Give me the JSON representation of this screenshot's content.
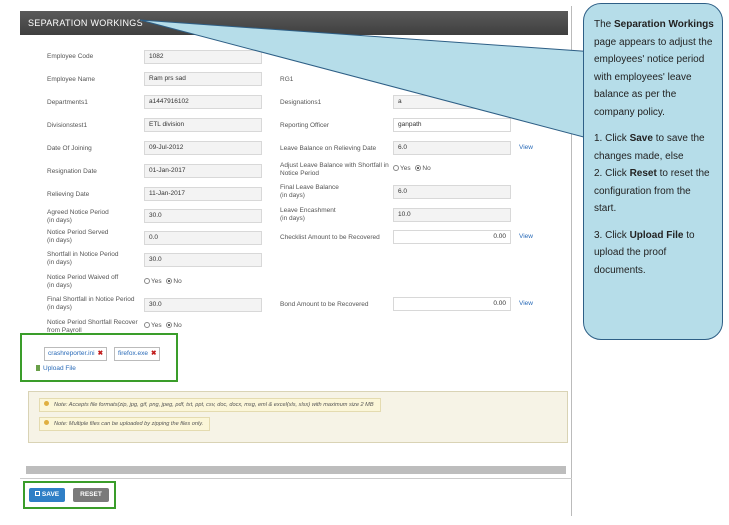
{
  "header": {
    "title": "SEPARATION WORKINGS"
  },
  "fields": {
    "employee_code": {
      "label": "Employee Code",
      "value": "1082"
    },
    "employee_name": {
      "label": "Employee Name",
      "value": "Ram prs sad"
    },
    "rg1": {
      "label": "RG1",
      "value": ""
    },
    "departments": {
      "label": "Departments1",
      "value": "a1447916102"
    },
    "designations": {
      "label": "Designations1",
      "value": "a"
    },
    "divisions": {
      "label": "Divisionstest1",
      "value": "ETL division"
    },
    "reporting_officer": {
      "label": "Reporting Officer",
      "value": "ganpath"
    },
    "date_of_joining": {
      "label": "Date Of Joining",
      "value": "09-Jul-2012"
    },
    "leave_balance_relieving": {
      "label": "Leave Balance on Relieving Date",
      "value": "6.0"
    },
    "resignation_date": {
      "label": "Resignation Date",
      "value": "01-Jan-2017"
    },
    "adjust_leave": {
      "label_l1": "Adjust Leave Balance with Shortfall in",
      "label_l2": "Notice Period",
      "opt_yes": "Yes",
      "opt_no": "No"
    },
    "relieving_date": {
      "label": "Relieving Date",
      "value": "11-Jan-2017"
    },
    "final_leave_balance": {
      "label_l1": "Final Leave Balance",
      "label_l2": "(in days)",
      "value": "6.0"
    },
    "agreed_notice": {
      "label_l1": "Agreed Notice Period",
      "label_l2": "(in days)",
      "value": "30.0"
    },
    "leave_encashment": {
      "label_l1": "Leave Encashment",
      "label_l2": "(in days)",
      "value": "10.0"
    },
    "notice_served": {
      "label_l1": "Notice Period Served",
      "label_l2": "(in days)",
      "value": "0.0"
    },
    "checklist_amount": {
      "label": "Checklist Amount to be Recovered",
      "value": "0.00"
    },
    "shortfall_notice": {
      "label_l1": "Shortfall in Notice Period",
      "label_l2": "(in days)",
      "value": "30.0"
    },
    "notice_waived": {
      "label_l1": "Notice Period Waived off",
      "label_l2": "(in days)",
      "opt_yes": "Yes",
      "opt_no": "No"
    },
    "final_shortfall": {
      "label_l1": "Final Shortfall in Notice Period",
      "label_l2": "(in days)",
      "value": "30.0"
    },
    "bond_amount": {
      "label": "Bond Amount to be Recovered",
      "value": "0.00"
    },
    "shortfall_recover": {
      "label_l1": "Notice Period Shortfall Recover",
      "label_l2": "from Payroll",
      "opt_yes": "Yes",
      "opt_no": "No"
    }
  },
  "view_link": "View",
  "attachments": {
    "files": [
      "crashreporter.ini",
      "firefox.exe"
    ],
    "upload_label": "Upload File"
  },
  "notes": [
    "Note: Accepts file formats(zip, jpg, gif, png, jpeg, pdf, txt, ppt, csv, doc, docx, msg, eml & excel(xls, xlsx) with maximum size 2 MB",
    "Note: Multiple files can be uploaded by zipping the files only."
  ],
  "buttons": {
    "save": "SAVE",
    "reset": "RESET"
  },
  "callout": {
    "p1_pre": "The ",
    "p1_bold": "Separation Workings",
    "p1_post": " page appears to adjust the employees' notice period with employees' leave balance as per the company policy.",
    "s1_pre": "1. Click ",
    "s1_bold": "Save",
    "s1_post": " to save the changes made, else",
    "s2_pre": "2. Click ",
    "s2_bold": "Reset",
    "s2_post": " to reset the configuration from the start.",
    "s3_pre": "3. Click ",
    "s3_bold": "Upload File",
    "s3_post": " to upload the proof documents."
  },
  "colors": {
    "header_bg": "#4a4a4a",
    "callout_bg": "#b6dde9",
    "highlight_border": "#3a9d2a",
    "save_button": "#2f7fc6",
    "reset_button": "#7a7a7a"
  }
}
